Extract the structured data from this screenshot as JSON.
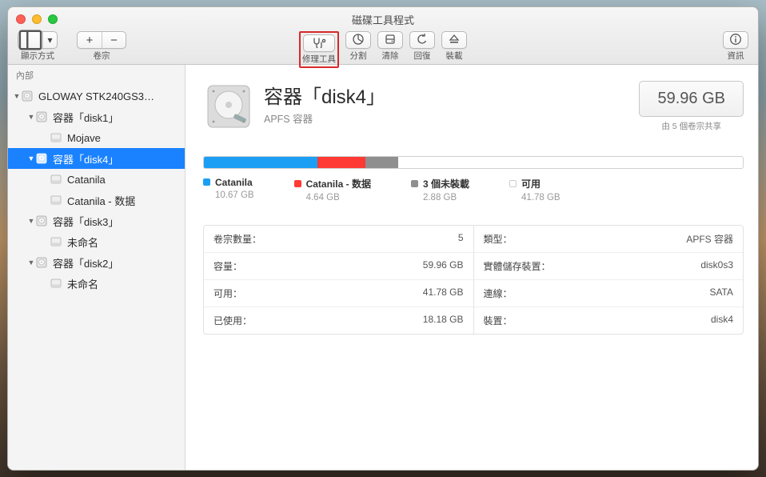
{
  "window": {
    "title": "磁碟工具程式"
  },
  "toolbar": {
    "view_label": "顯示方式",
    "volume_label": "卷宗",
    "repair_label": "修理工具",
    "partition_label": "分割",
    "erase_label": "清除",
    "restore_label": "回復",
    "mount_label": "裝載",
    "info_label": "資訊"
  },
  "sidebar": {
    "section": "內部",
    "tree": [
      {
        "label": "GLOWAY STK240GS3…",
        "indent": 0,
        "expanded": true,
        "icon": "hdd"
      },
      {
        "label": "容器「disk1」",
        "indent": 1,
        "expanded": true,
        "icon": "hdd"
      },
      {
        "label": "Mojave",
        "indent": 2,
        "icon": "vol"
      },
      {
        "label": "容器「disk4」",
        "indent": 1,
        "expanded": true,
        "selected": true,
        "icon": "hdd"
      },
      {
        "label": "Catanila",
        "indent": 2,
        "icon": "vol"
      },
      {
        "label": "Catanila - 数据",
        "indent": 2,
        "icon": "vol"
      },
      {
        "label": "容器「disk3」",
        "indent": 1,
        "expanded": true,
        "icon": "hdd"
      },
      {
        "label": "未命名",
        "indent": 2,
        "icon": "vol"
      },
      {
        "label": "容器「disk2」",
        "indent": 1,
        "expanded": true,
        "icon": "hdd"
      },
      {
        "label": "未命名",
        "indent": 2,
        "icon": "vol"
      }
    ]
  },
  "disk": {
    "title": "容器「disk4」",
    "subtitle": "APFS 容器",
    "capacity": "59.96 GB",
    "shared_text": "由 5 個卷宗共享"
  },
  "usage": {
    "segments": [
      {
        "name": "Catanila",
        "value": "10.67 GB",
        "color": "#1a9ff5",
        "pct": 21
      },
      {
        "name": "Catanila - 数据",
        "value": "4.64 GB",
        "color": "#ff3a34",
        "pct": 9
      },
      {
        "name_prefix": "3 個未裝載",
        "value": "2.88 GB",
        "color": "#8f8f8f",
        "pct": 6
      },
      {
        "name": "可用",
        "value": "41.78 GB",
        "color": "#ffffff",
        "pct": 64,
        "border": true
      }
    ]
  },
  "info": {
    "left": [
      {
        "k": "卷宗數量：",
        "v": "5"
      },
      {
        "k": "容量：",
        "v": "59.96 GB"
      },
      {
        "k": "可用：",
        "v": "41.78 GB"
      },
      {
        "k": "已使用：",
        "v": "18.18 GB"
      }
    ],
    "right": [
      {
        "k": "類型：",
        "v": "APFS 容器"
      },
      {
        "k": "實體儲存裝置：",
        "v": "disk0s3"
      },
      {
        "k": "連線：",
        "v": "SATA"
      },
      {
        "k": "裝置：",
        "v": "disk4"
      }
    ]
  }
}
